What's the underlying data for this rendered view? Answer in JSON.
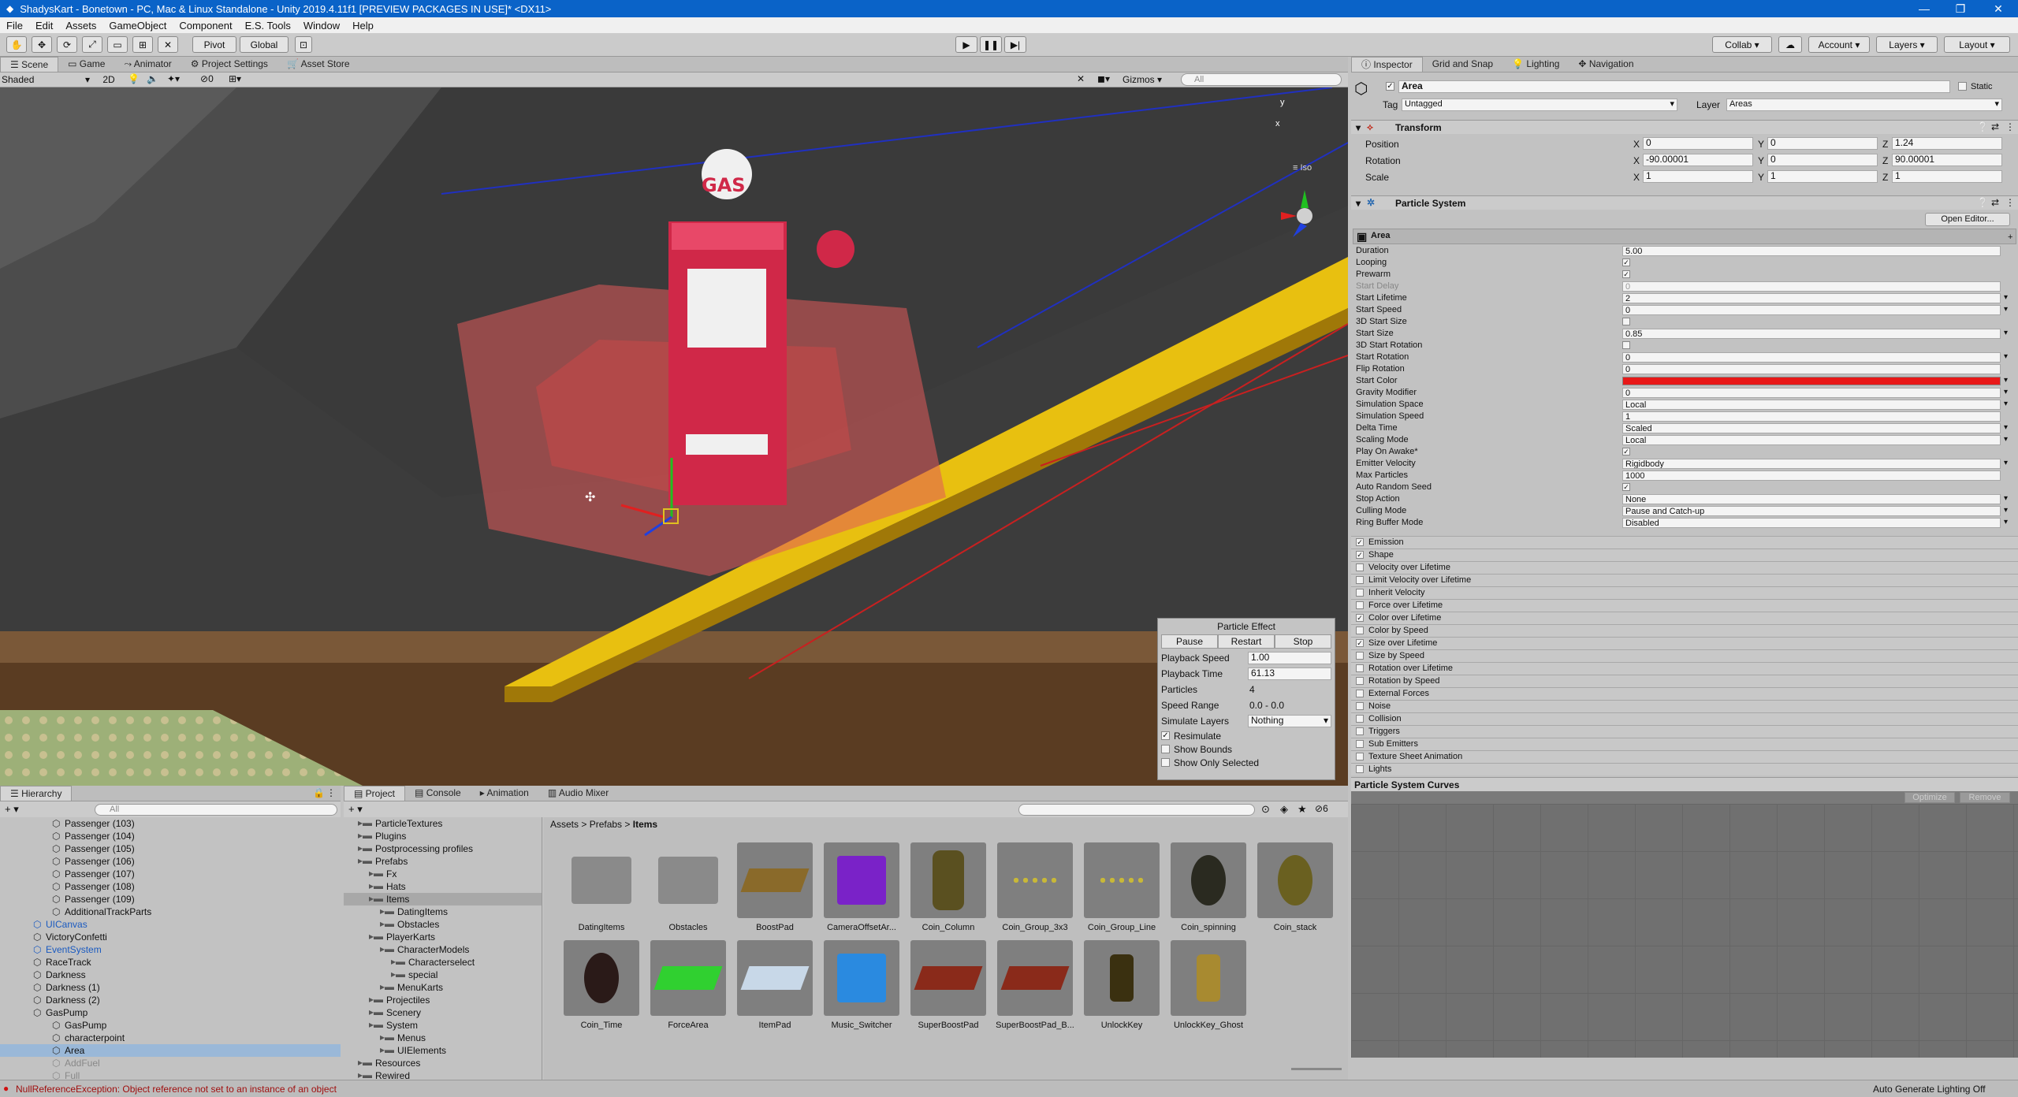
{
  "window": {
    "title": "ShadysKart - Bonetown - PC, Mac & Linux Standalone - Unity 2019.4.11f1 [PREVIEW PACKAGES IN USE]* <DX11>"
  },
  "menu": [
    "File",
    "Edit",
    "Assets",
    "GameObject",
    "Component",
    "E.S. Tools",
    "Window",
    "Help"
  ],
  "toolbar": {
    "pivot": "Pivot",
    "global": "Global",
    "collab": "Collab",
    "account": "Account",
    "layers": "Layers",
    "layout": "Layout"
  },
  "scene_tabs": [
    "Scene",
    "Game",
    "Animator",
    "Project Settings",
    "Asset Store"
  ],
  "scene_bar": {
    "shading": "Shaded",
    "mode2d": "2D",
    "gizmos": "Gizmos",
    "search_placeholder": "All",
    "hidden_count": "0"
  },
  "scene_overlay": {
    "sign": "GAS",
    "gizmo_view": "Iso",
    "gizmo_y": "y",
    "gizmo_x": "x"
  },
  "particle_effect": {
    "title": "Particle Effect",
    "buttons": [
      "Pause",
      "Restart",
      "Stop"
    ],
    "playback_speed_label": "Playback Speed",
    "playback_speed": "1.00",
    "playback_time_label": "Playback Time",
    "playback_time": "61.13",
    "particles_label": "Particles",
    "particles": "4",
    "speed_range_label": "Speed Range",
    "speed_range": "0.0 - 0.0",
    "simulate_layers_label": "Simulate Layers",
    "simulate_layers": "Nothing",
    "resimulate": "Resimulate",
    "show_bounds": "Show Bounds",
    "show_only_selected": "Show Only Selected"
  },
  "hierarchy": {
    "tab": "Hierarchy",
    "search_placeholder": "All",
    "items": [
      {
        "label": "Passenger (103)",
        "indent": 5,
        "dim": false
      },
      {
        "label": "Passenger (104)",
        "indent": 5,
        "dim": false
      },
      {
        "label": "Passenger (105)",
        "indent": 5,
        "dim": false
      },
      {
        "label": "Passenger (106)",
        "indent": 5,
        "dim": false
      },
      {
        "label": "Passenger (107)",
        "indent": 5,
        "dim": false
      },
      {
        "label": "Passenger (108)",
        "indent": 5,
        "dim": false
      },
      {
        "label": "Passenger (109)",
        "indent": 5,
        "dim": false
      },
      {
        "label": "AdditionalTrackParts",
        "indent": 5,
        "dim": false
      },
      {
        "label": "UICanvas",
        "indent": 3,
        "dim": false,
        "blue": true
      },
      {
        "label": "VictoryConfetti",
        "indent": 3,
        "dim": false
      },
      {
        "label": "EventSystem",
        "indent": 3,
        "dim": false,
        "blue": true
      },
      {
        "label": "RaceTrack",
        "indent": 3,
        "dim": false
      },
      {
        "label": "Darkness",
        "indent": 3,
        "dim": false
      },
      {
        "label": "Darkness (1)",
        "indent": 3,
        "dim": false
      },
      {
        "label": "Darkness (2)",
        "indent": 3,
        "dim": false
      },
      {
        "label": "GasPump",
        "indent": 3,
        "dim": false
      },
      {
        "label": "GasPump",
        "indent": 5,
        "dim": false
      },
      {
        "label": "characterpoint",
        "indent": 5,
        "dim": false
      },
      {
        "label": "Area",
        "indent": 5,
        "dim": false,
        "selected": true
      },
      {
        "label": "AddFuel",
        "indent": 5,
        "dim": true
      },
      {
        "label": "Full",
        "indent": 5,
        "dim": true
      }
    ]
  },
  "project": {
    "tabs": [
      "Project",
      "Console",
      "Animation",
      "Audio Mixer"
    ],
    "hidden_count": "6",
    "tree": [
      {
        "label": "ParticleTextures",
        "indent": 1
      },
      {
        "label": "Plugins",
        "indent": 1
      },
      {
        "label": "Postprocessing profiles",
        "indent": 1
      },
      {
        "label": "Prefabs",
        "indent": 1
      },
      {
        "label": "Fx",
        "indent": 2
      },
      {
        "label": "Hats",
        "indent": 2
      },
      {
        "label": "Items",
        "indent": 2,
        "selected": true
      },
      {
        "label": "DatingItems",
        "indent": 3
      },
      {
        "label": "Obstacles",
        "indent": 3
      },
      {
        "label": "PlayerKarts",
        "indent": 2
      },
      {
        "label": "CharacterModels",
        "indent": 3
      },
      {
        "label": "Characterselect",
        "indent": 4
      },
      {
        "label": "special",
        "indent": 4
      },
      {
        "label": "MenuKarts",
        "indent": 3
      },
      {
        "label": "Projectiles",
        "indent": 2
      },
      {
        "label": "Scenery",
        "indent": 2
      },
      {
        "label": "System",
        "indent": 2
      },
      {
        "label": "Menus",
        "indent": 3
      },
      {
        "label": "UIElements",
        "indent": 3
      },
      {
        "label": "Resources",
        "indent": 1
      },
      {
        "label": "Rewired",
        "indent": 1
      }
    ],
    "breadcrumb": [
      "Assets",
      "Prefabs",
      "Items"
    ],
    "assets": [
      {
        "label": "DatingItems",
        "kind": "folder"
      },
      {
        "label": "Obstacles",
        "kind": "folder"
      },
      {
        "label": "BoostPad",
        "kind": "pad",
        "color": "#8a6a2a"
      },
      {
        "label": "CameraOffsetAr...",
        "kind": "cube",
        "color": "#7a22c8"
      },
      {
        "label": "Coin_Column",
        "kind": "stack",
        "color": "#5a5020"
      },
      {
        "label": "Coin_Group_3x3",
        "kind": "dots",
        "color": "#c8b838"
      },
      {
        "label": "Coin_Group_Line",
        "kind": "dots",
        "color": "#c8b838"
      },
      {
        "label": "Coin_spinning",
        "kind": "coin",
        "color": "#2a2a20"
      },
      {
        "label": "Coin_stack",
        "kind": "coin",
        "color": "#6a6020"
      },
      {
        "label": "Coin_Time",
        "kind": "coin",
        "color": "#2a1a18"
      },
      {
        "label": "ForceArea",
        "kind": "pad",
        "color": "#30d030"
      },
      {
        "label": "ItemPad",
        "kind": "pad",
        "color": "#c8d8e8"
      },
      {
        "label": "Music_Switcher",
        "kind": "cube",
        "color": "#2a8ae0"
      },
      {
        "label": "SuperBoostPad",
        "kind": "pad",
        "color": "#8a2a1a"
      },
      {
        "label": "SuperBoostPad_B...",
        "kind": "pad",
        "color": "#8a2a1a"
      },
      {
        "label": "UnlockKey",
        "kind": "key",
        "color": "#3a3010"
      },
      {
        "label": "UnlockKey_Ghost",
        "kind": "key",
        "color": "#a88a30"
      }
    ]
  },
  "inspector": {
    "tabs": [
      "Inspector",
      "Grid and Snap",
      "Lighting",
      "Navigation"
    ],
    "name": "Area",
    "static": "Static",
    "tag_label": "Tag",
    "tag": "Untagged",
    "layer_label": "Layer",
    "layer": "Areas",
    "transform": {
      "title": "Transform",
      "rows": [
        {
          "label": "Position",
          "x": "0",
          "y": "0",
          "z": "1.24"
        },
        {
          "label": "Rotation",
          "x": "-90.00001",
          "y": "0",
          "z": "90.00001"
        },
        {
          "label": "Scale",
          "x": "1",
          "y": "1",
          "z": "1"
        }
      ]
    },
    "particle_system": {
      "title": "Particle System",
      "open_editor": "Open Editor...",
      "module": "Area",
      "props": [
        {
          "label": "Duration",
          "value": "5.00"
        },
        {
          "label": "Looping",
          "check": true
        },
        {
          "label": "Prewarm",
          "check": true
        },
        {
          "label": "Start Delay",
          "value": "0",
          "dim": true
        },
        {
          "label": "Start Lifetime",
          "value": "2",
          "dd": true
        },
        {
          "label": "Start Speed",
          "value": "0",
          "dd": true
        },
        {
          "label": "3D Start Size",
          "check": false
        },
        {
          "label": "Start Size",
          "value": "0.85",
          "dd": true
        },
        {
          "label": "3D Start Rotation",
          "check": false
        },
        {
          "label": "Start Rotation",
          "value": "0",
          "dd": true
        },
        {
          "label": "Flip Rotation",
          "value": "0"
        },
        {
          "label": "Start Color",
          "color": "#e81818"
        },
        {
          "label": "Gravity Modifier",
          "value": "0",
          "dd": true
        },
        {
          "label": "Simulation Space",
          "value": "Local",
          "dd": true
        },
        {
          "label": "Simulation Speed",
          "value": "1"
        },
        {
          "label": "Delta Time",
          "value": "Scaled",
          "dd": true
        },
        {
          "label": "Scaling Mode",
          "value": "Local",
          "dd": true
        },
        {
          "label": "Play On Awake*",
          "check": true
        },
        {
          "label": "Emitter Velocity",
          "value": "Rigidbody",
          "dd": true
        },
        {
          "label": "Max Particles",
          "value": "1000"
        },
        {
          "label": "Auto Random Seed",
          "check": true
        },
        {
          "label": "Stop Action",
          "value": "None",
          "dd": true
        },
        {
          "label": "Culling Mode",
          "value": "Pause and Catch-up",
          "dd": true
        },
        {
          "label": "Ring Buffer Mode",
          "value": "Disabled",
          "dd": true
        }
      ],
      "modules": [
        {
          "label": "Emission",
          "on": true
        },
        {
          "label": "Shape",
          "on": true
        },
        {
          "label": "Velocity over Lifetime",
          "on": false
        },
        {
          "label": "Limit Velocity over Lifetime",
          "on": false
        },
        {
          "label": "Inherit Velocity",
          "on": false
        },
        {
          "label": "Force over Lifetime",
          "on": false
        },
        {
          "label": "Color over Lifetime",
          "on": true
        },
        {
          "label": "Color by Speed",
          "on": false
        },
        {
          "label": "Size over Lifetime",
          "on": true
        },
        {
          "label": "Size by Speed",
          "on": false
        },
        {
          "label": "Rotation over Lifetime",
          "on": false
        },
        {
          "label": "Rotation by Speed",
          "on": false
        },
        {
          "label": "External Forces",
          "on": false
        },
        {
          "label": "Noise",
          "on": false
        },
        {
          "label": "Collision",
          "on": false
        },
        {
          "label": "Triggers",
          "on": false
        },
        {
          "label": "Sub Emitters",
          "on": false
        },
        {
          "label": "Texture Sheet Animation",
          "on": false
        },
        {
          "label": "Lights",
          "on": false
        }
      ],
      "curves": "Particle System Curves",
      "optimize": "Optimize",
      "remove": "Remove"
    }
  },
  "status": {
    "error": "NullReferenceException: Object reference not set to an instance of an object",
    "lighting": "Auto Generate Lighting Off"
  }
}
